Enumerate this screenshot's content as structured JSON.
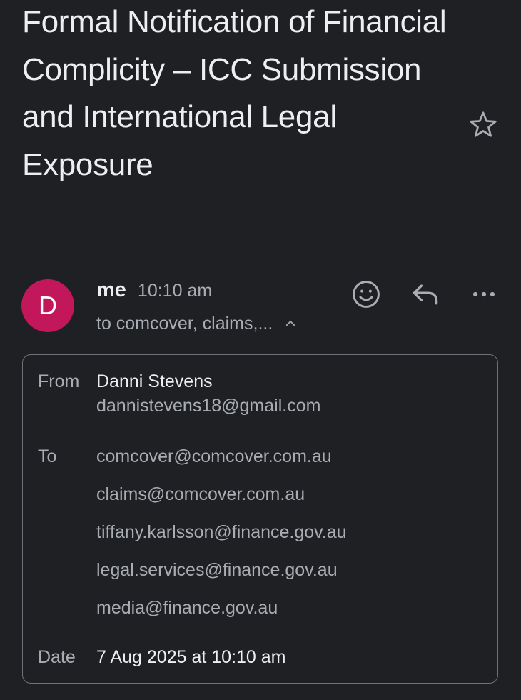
{
  "email": {
    "subject": "Formal Notification of Financial Complicity – ICC Submission and International Legal Exposure",
    "sender": {
      "avatar_letter": "D",
      "avatar_color": "#c2185b",
      "name": "me",
      "time": "10:10 am",
      "recipients_summary": "to comcover, claims,..."
    },
    "details": {
      "from_label": "From",
      "from_name": "Danni Stevens",
      "from_email": "dannistevens18@gmail.com",
      "to_label": "To",
      "to": [
        "comcover@comcover.com.au",
        "claims@comcover.com.au",
        "tiffany.karlsson@finance.gov.au",
        "legal.services@finance.gov.au",
        "media@finance.gov.au"
      ],
      "date_label": "Date",
      "date": "7 Aug 2025 at 10:10 am"
    }
  },
  "icons": {
    "star": "star-icon",
    "emoji": "emoji-icon",
    "reply": "reply-icon",
    "more": "more-vert-icon",
    "chevron": "chevron-up-icon"
  },
  "theme": {
    "background": "#1f2023",
    "text": "#eceef1",
    "muted_text": "#a9adb3",
    "border": "#6e7177"
  }
}
